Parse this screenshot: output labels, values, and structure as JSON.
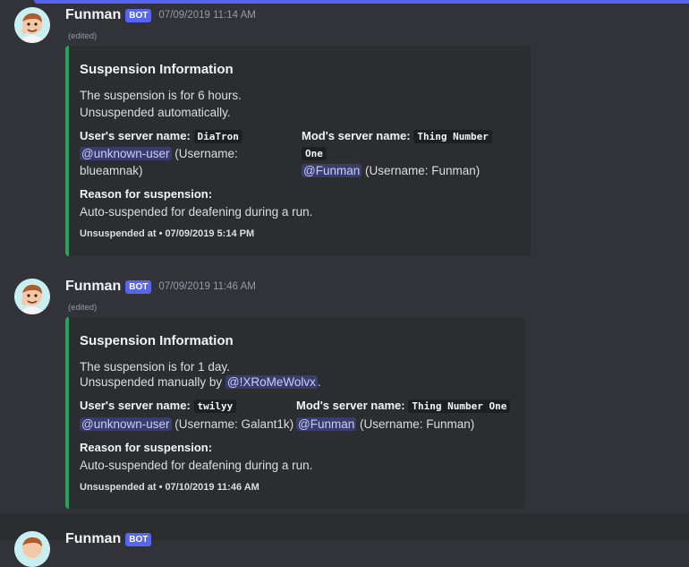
{
  "messages": [
    {
      "username": "Funman",
      "badge": "BOT",
      "timestamp": "07/09/2019 11:14 AM",
      "edited": "(edited)",
      "embed": {
        "title": "Suspension Information",
        "desc_line1": "The suspension is for 6 hours.",
        "desc_line2": "Unsuspended automatically.",
        "user_field_label": "User's server name:",
        "user_server_name": "DiaTron",
        "user_mention": "@unknown-user",
        "user_username_a": "(Username:",
        "user_username_b": "blueamnak)",
        "mod_field_label": "Mod's server name:",
        "mod_server_name_a": "Thing Number",
        "mod_server_name_b": "One",
        "mod_mention": "@Funman",
        "mod_username": "(Username: Funman)",
        "reason_label": "Reason for suspension:",
        "reason": "Auto-suspended for deafening during a run.",
        "footer_label": "Unsuspended at",
        "footer_sep": "•",
        "footer_time": "07/09/2019 5:14 PM"
      }
    },
    {
      "username": "Funman",
      "badge": "BOT",
      "timestamp": "07/09/2019 11:46 AM",
      "edited": "(edited)",
      "embed": {
        "title": "Suspension Information",
        "desc_line1": "The suspension is for 1 day.",
        "desc_line2": "Unsuspended manually by",
        "desc_mention": "@!XRoMeWolvx",
        "desc_end": ".",
        "user_field_label": "User's server name:",
        "user_server_name": "twilyy",
        "user_mention": "@unknown-user",
        "user_username": "(Username: Galant1k)",
        "mod_field_label": "Mod's server name:",
        "mod_server_name": "Thing Number One",
        "mod_mention": "@Funman",
        "mod_username": "(Username: Funman)",
        "reason_label": "Reason for suspension:",
        "reason": "Auto-suspended for deafening during a run.",
        "footer_label": "Unsuspended at",
        "footer_sep": "•",
        "footer_time": "07/10/2019 11:46 AM"
      }
    },
    {
      "username": "Funman",
      "badge": "BOT"
    }
  ],
  "colors": {
    "background": "#313338",
    "embed_bg": "#2b2d31",
    "embed_border": "#23a559",
    "badge": "#5865f2",
    "mention_bg": "#3c4270"
  }
}
